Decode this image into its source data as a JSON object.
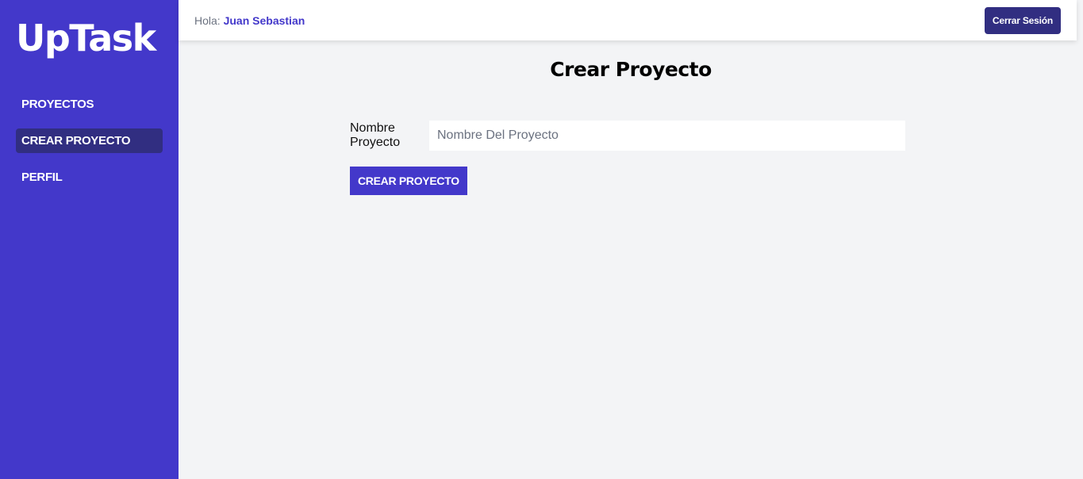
{
  "sidebar": {
    "logo": "UpTask",
    "items": [
      {
        "label": "PROYECTOS",
        "active": false
      },
      {
        "label": "CREAR PROYECTO",
        "active": true
      },
      {
        "label": "PERFIL",
        "active": false
      }
    ]
  },
  "header": {
    "greeting_prefix": "Hola:",
    "user_name": "Juan Sebastian",
    "logout_label": "Cerrar Sesión"
  },
  "main": {
    "title": "Crear Proyecto",
    "form": {
      "name_label": "Nombre Proyecto",
      "name_value": "",
      "name_placeholder": "Nombre Del Proyecto",
      "submit_label": "CREAR PROYECTO"
    }
  },
  "colors": {
    "sidebar_bg": "#4338ca",
    "active_item_bg": "#312e81",
    "logout_bg": "#312e81",
    "accent_text": "#4338ca",
    "page_bg": "#f3f4f6"
  }
}
